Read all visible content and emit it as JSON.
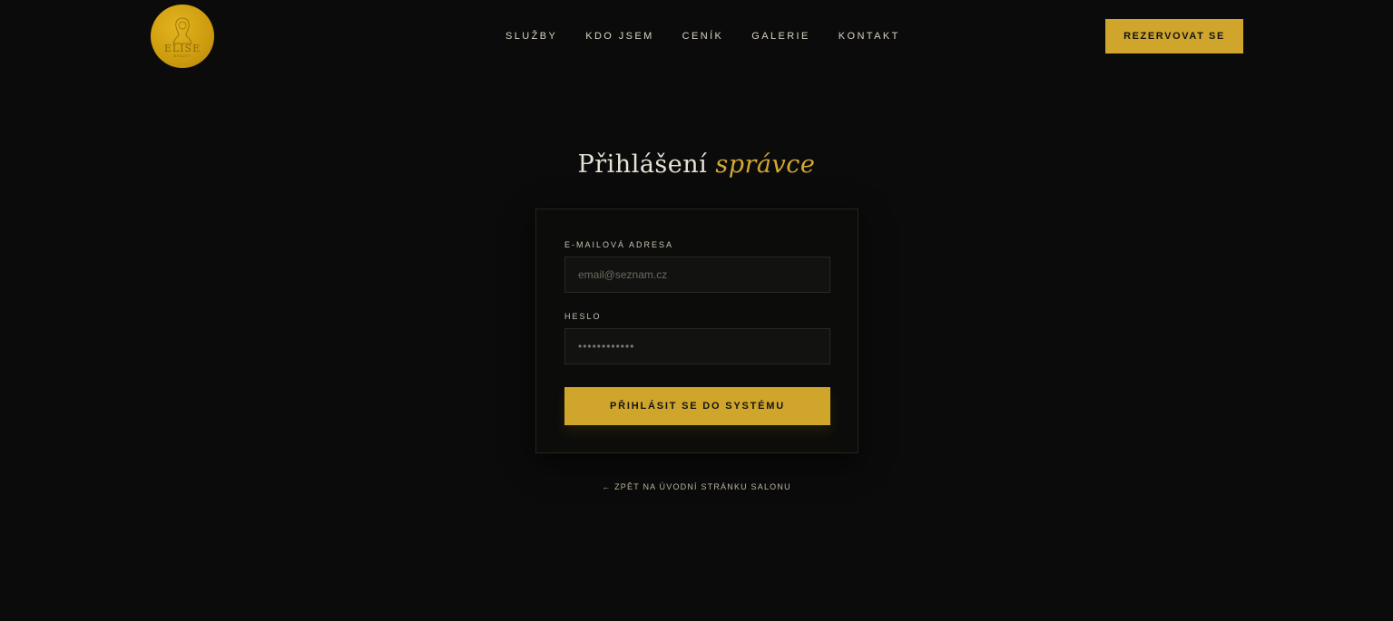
{
  "header": {
    "logo_text": "ELISE",
    "logo_sub": "BEAUTY",
    "nav": [
      {
        "label": "SLUŽBY"
      },
      {
        "label": "KDO JSEM"
      },
      {
        "label": "CENÍK"
      },
      {
        "label": "GALERIE"
      },
      {
        "label": "KONTAKT"
      }
    ],
    "cta_label": "REZERVOVAT SE"
  },
  "login": {
    "title_main": "Přihlášení",
    "title_accent": "správce",
    "email_label": "E-MAILOVÁ ADRESA",
    "email_placeholder": "email@seznam.cz",
    "password_label": "HESLO",
    "password_value": "••••••••••••",
    "submit_label": "PŘIHLÁSIT SE DO SYSTÉMU",
    "back_link": "← ZPĚT NA ÚVODNÍ STRÁNKU SALONU"
  },
  "colors": {
    "background": "#0b0b0b",
    "accent": "#d0a52c",
    "text": "#d8d2c4"
  }
}
